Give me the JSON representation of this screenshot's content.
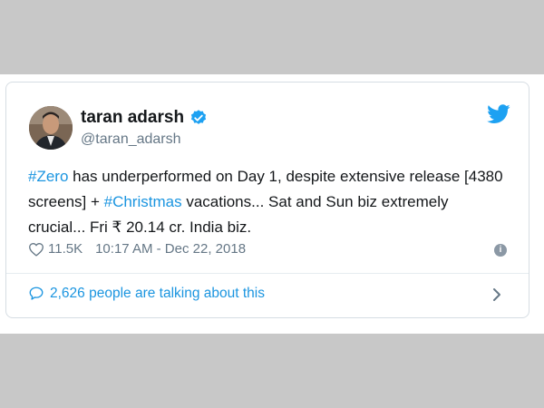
{
  "tweet": {
    "author": {
      "name": "taran adarsh",
      "handle": "@taran_adarsh"
    },
    "text_parts": {
      "p1": "#Zero",
      "p2": " has underperformed on Day 1, despite extensive release [4380 screens] + ",
      "p3": "#Christmas",
      "p4": " vacations... Sat and Sun biz extremely crucial... Fri ₹ 20.14 cr. India biz."
    },
    "likes": "11.5K",
    "timestamp": "10:17 AM - Dec 22, 2018",
    "info_glyph": "i",
    "discussion": "2,626 people are talking about this"
  },
  "colors": {
    "link": "#1b95e0",
    "secondary_text": "#657786",
    "primary_text": "#14171a",
    "verified": "#1da1f2"
  },
  "icons": [
    "verified-badge-icon",
    "twitter-bird-icon",
    "heart-icon",
    "info-icon",
    "chat-bubble-icon",
    "chevron-right-icon"
  ]
}
